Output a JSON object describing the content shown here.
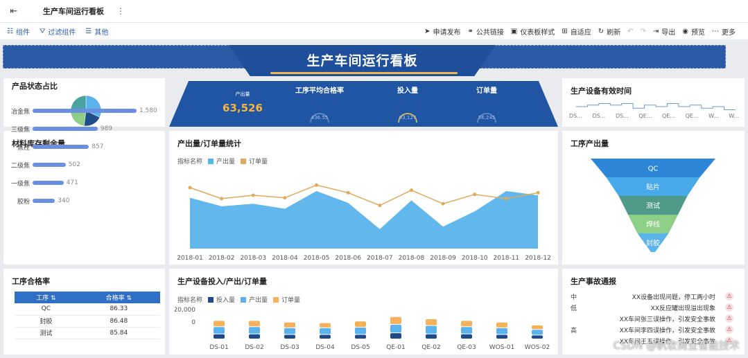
{
  "topbar": {
    "title": "生产车间运行看板",
    "more": "⋮"
  },
  "toolbar": {
    "left": [
      "组件",
      "过滤组件",
      "其他"
    ],
    "right": [
      "申请发布",
      "公共链接",
      "仪表板样式",
      "自适应",
      "刷新",
      "导出",
      "预览",
      "更多"
    ]
  },
  "banner": {
    "title": "生产车间运行看板"
  },
  "kpi": {
    "output_label": "产出量",
    "output_value": "63,526",
    "pass_rate_label": "工序平均合格率",
    "pass_rate_value": "436.55",
    "input_label": "投入量",
    "input_value": "63,127",
    "orders_label": "订单量",
    "orders_value": "56,245"
  },
  "product_status": {
    "title": "产品状态占比",
    "slices": [
      0.32,
      0.2,
      0.23,
      0.25
    ],
    "colors": [
      "#5ab3ec",
      "#1f4f86",
      "#8ecf87",
      "#4aa3a0"
    ]
  },
  "equip_time": {
    "title": "生产设备有效时间",
    "labels": [
      "DS...",
      "DS...",
      "DS...",
      "QE...",
      "QE...",
      "QE...",
      "W...",
      "W..."
    ]
  },
  "inventory": {
    "title": "材料库存剩余量",
    "items": [
      {
        "label": "冶金焦",
        "value": "1,580",
        "num": 1580
      },
      {
        "label": "三级焦",
        "value": "989",
        "num": 989
      },
      {
        "label": "焦控",
        "value": "857",
        "num": 857
      },
      {
        "label": "二级焦",
        "value": "502",
        "num": 502
      },
      {
        "label": "一级焦",
        "value": "471",
        "num": 471
      },
      {
        "label": "胶粉",
        "value": "340",
        "num": 340
      }
    ]
  },
  "output_orders": {
    "title": "产出量/订单量统计",
    "legend_name": "指标名称",
    "series_names": [
      "产出量",
      "订单量"
    ]
  },
  "process_output": {
    "title": "工序产出量",
    "stages": [
      "QC",
      "贴片",
      "测试",
      "焊线",
      "封胶"
    ]
  },
  "quality": {
    "title": "工序合格率",
    "headers": [
      "工序",
      "合格率"
    ],
    "rows": [
      [
        "QC",
        "86.33"
      ],
      [
        "封胶",
        "86.48"
      ],
      [
        "测试",
        "85.84"
      ]
    ]
  },
  "equip_chart": {
    "title": "生产设备投入/产出/订单量",
    "legend_name": "指标名称",
    "series_names": [
      "投入量",
      "产出量",
      "订单量"
    ],
    "colors": [
      "#1e4a8a",
      "#5ab3ec",
      "#f5b25a"
    ],
    "y_ticks": [
      "20,000",
      "0"
    ]
  },
  "accidents": {
    "title": "生产事故通报",
    "items": [
      {
        "level": "中",
        "text": "XX设备出现问题，停工两小时"
      },
      {
        "level": "低",
        "text": "XX反应罐出现溢出现象"
      },
      {
        "level": "",
        "text": "XX车间张三误操作，引发安全事故"
      },
      {
        "level": "高",
        "text": "XX车间李四误操作，引发安全事故"
      },
      {
        "level": "",
        "text": "XX车间王五误操作，引发安全事故"
      }
    ]
  },
  "watermark": "CSDN @帆软商业智能技术",
  "chart_data": [
    {
      "type": "area",
      "title": "产出量/订单量统计",
      "categories": [
        "2018-01",
        "2018-02",
        "2018-03",
        "2018-04",
        "2018-05",
        "2018-06",
        "2018-07",
        "2018-08",
        "2018-09",
        "2018-10",
        "2018-11",
        "2018-12"
      ],
      "series": [
        {
          "name": "产出量",
          "values": [
            6000,
            5000,
            5300,
            4700,
            6800,
            5400,
            2300,
            5700,
            2600,
            4400,
            6800,
            6300
          ]
        },
        {
          "name": "订单量",
          "values": [
            7200,
            5900,
            6300,
            6000,
            7500,
            6600,
            5100,
            6900,
            5300,
            6400,
            5900,
            6600
          ]
        }
      ],
      "ylim": [
        0,
        9000
      ]
    },
    {
      "type": "bar",
      "title": "生产设备投入/产出/订单量",
      "categories": [
        "DS-01",
        "DS-02",
        "DS-03",
        "DS-04",
        "DS-05",
        "QE-01",
        "QE-02",
        "QE-03",
        "WOS-01",
        "WOS-02"
      ],
      "series": [
        {
          "name": "投入量",
          "values": [
            9000,
            9000,
            8000,
            8000,
            8000,
            11000,
            9000,
            9000,
            8000,
            7000
          ]
        },
        {
          "name": "产出量",
          "values": [
            13000,
            13000,
            12000,
            12000,
            13000,
            15000,
            15000,
            13000,
            12000,
            10000
          ]
        },
        {
          "name": "订单量",
          "values": [
            11000,
            11000,
            10000,
            9000,
            11000,
            14000,
            12000,
            11000,
            10000,
            8000
          ]
        }
      ],
      "y_ticks": [
        "20,000",
        "0"
      ]
    },
    {
      "type": "line",
      "title": "生产设备有效时间",
      "categories": [
        "DS...",
        "DS...",
        "DS...",
        "QE...",
        "QE...",
        "QE...",
        "W...",
        "W..."
      ],
      "series": [
        {
          "values": [
            4,
            5,
            6,
            5,
            6,
            3,
            5,
            4,
            6,
            4,
            5,
            3,
            4,
            2
          ]
        }
      ]
    },
    {
      "type": "funnel",
      "title": "工序产出量",
      "categories": [
        "QC",
        "贴片",
        "测试",
        "焊线",
        "封胶"
      ],
      "values": [
        100,
        75,
        55,
        40,
        25
      ]
    }
  ]
}
